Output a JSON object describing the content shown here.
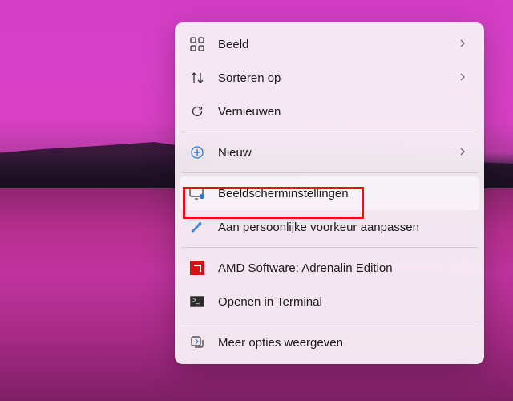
{
  "menu": {
    "items": [
      {
        "label": "Beeld",
        "icon": "view-icon",
        "submenu": true
      },
      {
        "label": "Sorteren op",
        "icon": "sort-icon",
        "submenu": true
      },
      {
        "label": "Vernieuwen",
        "icon": "refresh-icon",
        "submenu": false
      },
      {
        "label": "Nieuw",
        "icon": "new-icon",
        "submenu": true
      },
      {
        "label": "Beeldscherminstellingen",
        "icon": "display-settings-icon",
        "submenu": false
      },
      {
        "label": "Aan persoonlijke voorkeur aanpassen",
        "icon": "personalize-icon",
        "submenu": false
      },
      {
        "label": "AMD Software: Adrenalin Edition",
        "icon": "amd-icon",
        "submenu": false
      },
      {
        "label": "Openen in Terminal",
        "icon": "terminal-icon",
        "submenu": false
      },
      {
        "label": "Meer opties weergeven",
        "icon": "more-options-icon",
        "submenu": false
      }
    ]
  },
  "highlighted_index": 4
}
